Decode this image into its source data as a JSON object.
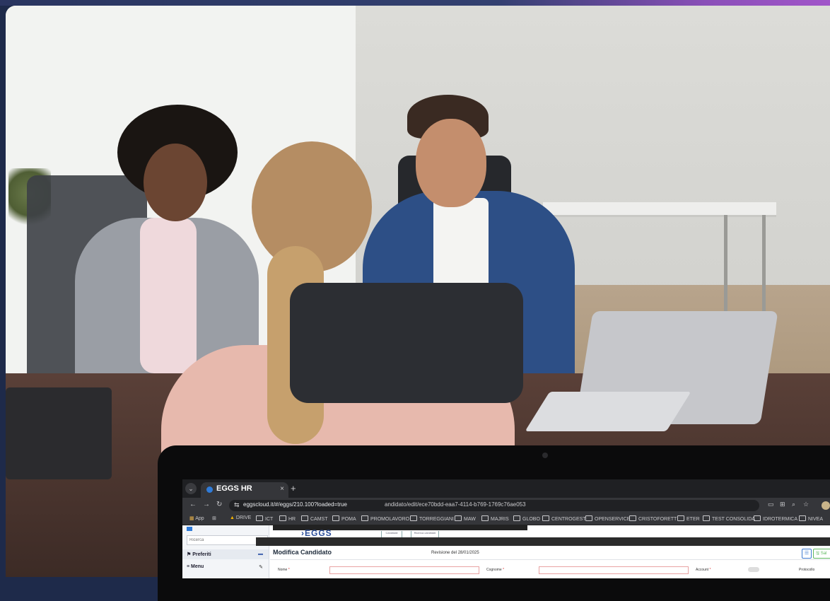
{
  "browser": {
    "tab_title": "EGGS HR",
    "tab_close": "×",
    "new_tab": "+",
    "url": "eggscloud.it/#/eggs/210.100?loaded=true",
    "url_suffix": "andidato/edit/ece70bdd-eaa7-4114-b769-1769c76ae053",
    "bookmarks": [
      "App",
      "DRIVE",
      "ICT",
      "HR",
      "CAMST",
      "POMA",
      "PROMOLAVORO",
      "TORREGGIANI",
      "MAW",
      "MAJRIS",
      "GLOBO",
      "CENTROGEST",
      "OPENSERVICE",
      "CRISTOFORETTI",
      "ETER",
      "TEST CONSOLIDA",
      "IDROTERMICA",
      "NIVEA"
    ]
  },
  "sidebar": {
    "search_placeholder": "Ricerca",
    "preferiti": "Preferiti",
    "menu": "Menu"
  },
  "header": {
    "logo": "EGGS",
    "tab1": "Candidati",
    "tab2": "Ricerca candidati"
  },
  "page": {
    "title": "Modifica Candidato",
    "revision": "Revisione del 28/01/2025",
    "save_label": "Sal",
    "fields": {
      "nome": "Nome",
      "cognome": "Cognome",
      "account": "Account",
      "protocollo": "Protocollo"
    }
  },
  "colors": {
    "accent": "#2f7bd8",
    "frame_gradient_end": "#a155c9"
  }
}
